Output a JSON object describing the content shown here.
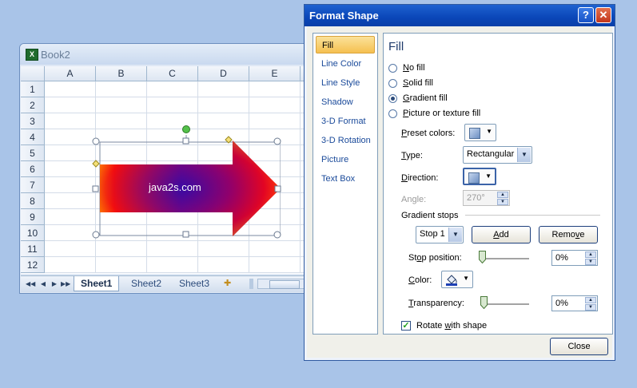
{
  "excel": {
    "title": "Book2",
    "app_icon_glyph": "X",
    "columns": [
      "A",
      "B",
      "C",
      "D",
      "E"
    ],
    "rows": [
      "1",
      "2",
      "3",
      "4",
      "5",
      "6",
      "7",
      "8",
      "9",
      "10",
      "11",
      "12"
    ],
    "shape_text": "java2s.com",
    "sheet_tabs": [
      "Sheet1",
      "Sheet2",
      "Sheet3"
    ],
    "active_sheet": "Sheet1",
    "nav_glyphs": [
      "◀◀",
      "◀",
      "▶",
      "▶▶"
    ]
  },
  "dialog": {
    "title": "Format Shape",
    "help_glyph": "?",
    "close_glyph": "✕",
    "nav": [
      "Fill",
      "Line Color",
      "Line Style",
      "Shadow",
      "3-D Format",
      "3-D Rotation",
      "Picture",
      "Text Box"
    ],
    "selected_nav": "Fill",
    "heading": "Fill",
    "radios": [
      {
        "pre": "N",
        "post": "o fill",
        "on": false
      },
      {
        "pre": "S",
        "post": "olid fill",
        "on": false
      },
      {
        "pre": "G",
        "post": "radient fill",
        "on": true
      },
      {
        "pre": "P",
        "post": "icture or texture fill",
        "on": false
      }
    ],
    "preset_label_pre": "P",
    "preset_label_post": "reset colors:",
    "type_label_pre": "T",
    "type_label_post": "ype:",
    "type_value": "Rectangular",
    "direction_label_pre": "D",
    "direction_label_post": "irection:",
    "angle_label": "Angle:",
    "angle_value": "270°",
    "gradient_stops_label": "Gradient stops",
    "stop_value": "Stop 1",
    "add_label_pre": "A",
    "add_label_post": "dd",
    "remove_label_pre": "Remo",
    "remove_label_mid": "v",
    "remove_label_post": "e",
    "stop_position_label_pre": "St",
    "stop_position_label_mid": "o",
    "stop_position_label_post": "p position:",
    "stop_position_value": "0%",
    "color_label_pre": "C",
    "color_label_post": "olor:",
    "transparency_label_pre": "T",
    "transparency_label_mid": "r",
    "transparency_label_post": "ansparency:",
    "transparency_value": "0%",
    "rotate_label_pre": "Rotate ",
    "rotate_label_mid": "w",
    "rotate_label_post": "ith shape",
    "rotate_checked": "✓",
    "close_button": "Close",
    "dropdown_glyph": "▼",
    "spin_up": "▲",
    "spin_down": "▼"
  },
  "colors": {
    "title_bar": "#0a46b8",
    "selected_nav": "#f5c050",
    "arrow_gradient": [
      "#ff6a00",
      "#e8001b",
      "#3b0aa0"
    ]
  }
}
